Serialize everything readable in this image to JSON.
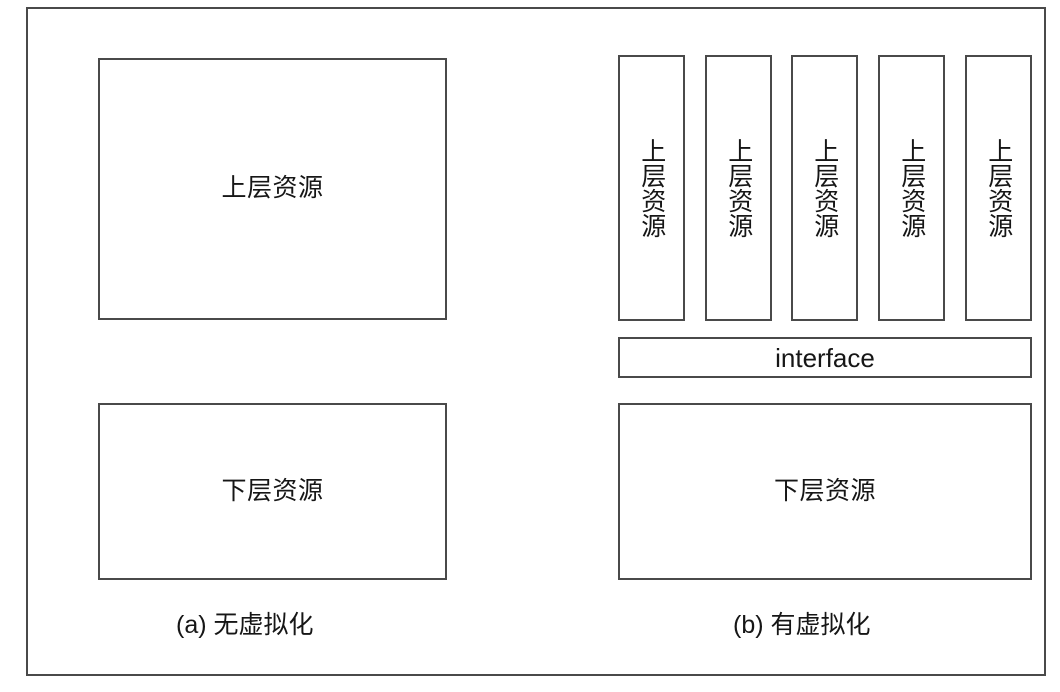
{
  "figure": {
    "type": "schematic-diagram",
    "frame_border_color": "#4a4a4a",
    "background_color": "#ffffff",
    "text_color": "#161616"
  },
  "panels": [
    {
      "id": "a",
      "caption": "(a) 无虚拟化",
      "boxes": [
        {
          "id": "a-upper",
          "label": "上层资源",
          "orientation": "horizontal"
        },
        {
          "id": "a-lower",
          "label": "下层资源",
          "orientation": "horizontal"
        }
      ]
    },
    {
      "id": "b",
      "caption": "(b) 有虚拟化",
      "vm_columns": [
        {
          "id": "vm-1",
          "label": "上层资源",
          "orientation": "vertical"
        },
        {
          "id": "vm-2",
          "label": "上层资源",
          "orientation": "vertical"
        },
        {
          "id": "vm-3",
          "label": "上层资源",
          "orientation": "vertical"
        },
        {
          "id": "vm-4",
          "label": "上层资源",
          "orientation": "vertical"
        },
        {
          "id": "vm-5",
          "label": "上层资源",
          "orientation": "vertical"
        }
      ],
      "interface": {
        "id": "b-interface",
        "label": "interface",
        "orientation": "horizontal"
      },
      "lower": {
        "id": "b-lower",
        "label": "下层资源",
        "orientation": "horizontal"
      }
    }
  ]
}
